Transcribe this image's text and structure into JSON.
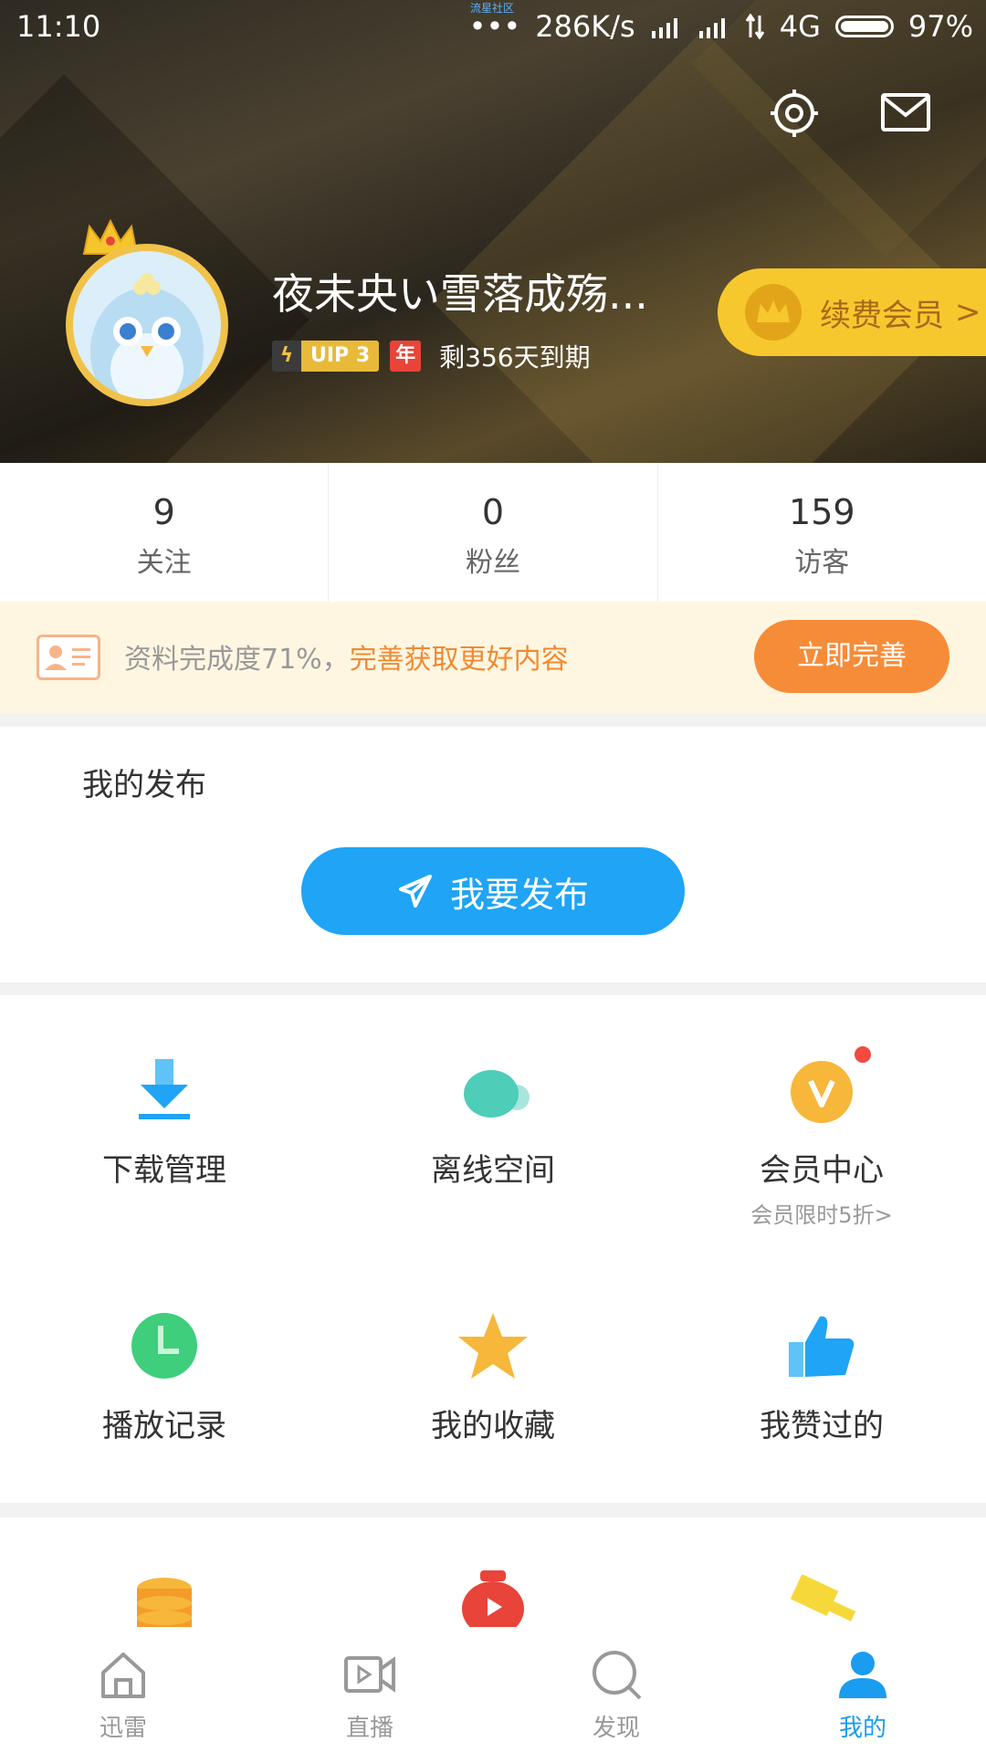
{
  "status_bar": {
    "time": "11:10",
    "tiny_label": "流星社区",
    "speed": "286K/s",
    "network": "4G",
    "battery": "97%"
  },
  "header": {
    "username": "夜未央い雪落成殇...",
    "vip_level": "UIP 3",
    "year_badge": "年",
    "expire_text": "剩356天到期",
    "renew_label": "续费会员",
    "renew_arrow": ">"
  },
  "stats": [
    {
      "value": "9",
      "label": "关注"
    },
    {
      "value": "0",
      "label": "粉丝"
    },
    {
      "value": "159",
      "label": "访客"
    }
  ],
  "profile_banner": {
    "text_plain": "资料完成度71%，",
    "text_highlight": "完善获取更好内容",
    "button": "立即完善"
  },
  "publish": {
    "title": "我的发布",
    "button": "我要发布"
  },
  "grid": [
    {
      "label": "下载管理",
      "sub": "",
      "icon": "download-icon"
    },
    {
      "label": "离线空间",
      "sub": "",
      "icon": "cloud-icon"
    },
    {
      "label": "会员中心",
      "sub": "会员限时5折>",
      "icon": "vip-icon"
    },
    {
      "label": "播放记录",
      "sub": "",
      "icon": "clock-icon"
    },
    {
      "label": "我的收藏",
      "sub": "",
      "icon": "star-icon"
    },
    {
      "label": "我赞过的",
      "sub": "",
      "icon": "thumbs-up-icon"
    }
  ],
  "tabs": [
    {
      "label": "迅雷",
      "icon": "home-icon",
      "active": false
    },
    {
      "label": "直播",
      "icon": "video-icon",
      "active": false
    },
    {
      "label": "发现",
      "icon": "search-icon",
      "active": false
    },
    {
      "label": "我的",
      "icon": "user-icon",
      "active": true
    }
  ],
  "colors": {
    "accent": "#1fa4f6",
    "orange": "#f78c38",
    "gold": "#f7c82e",
    "active_tab": "#1a9cf0"
  }
}
